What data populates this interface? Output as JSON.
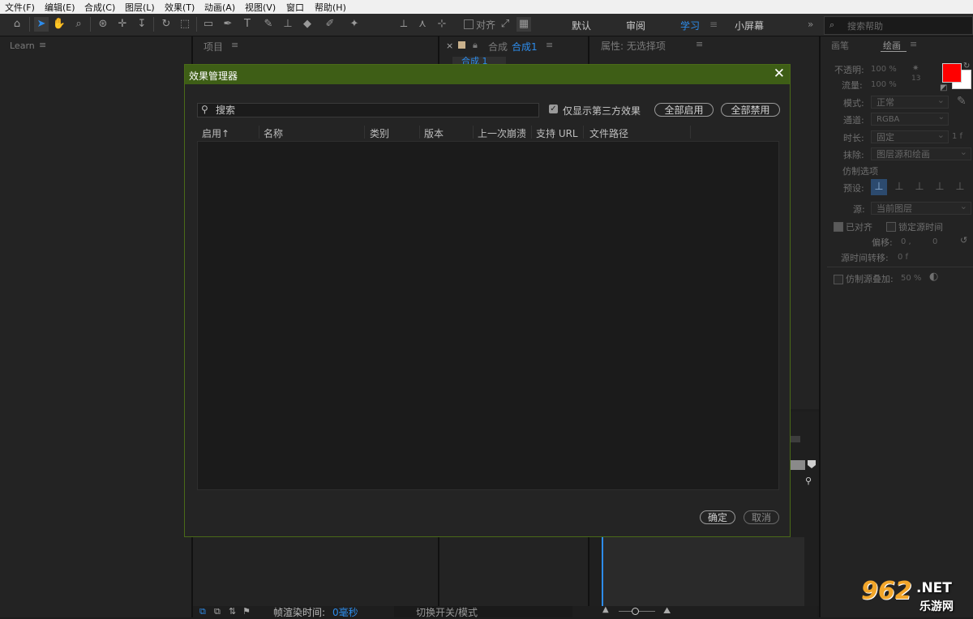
{
  "menu": [
    "文件(F)",
    "编辑(E)",
    "合成(C)",
    "图层(L)",
    "效果(T)",
    "动画(A)",
    "视图(V)",
    "窗口",
    "帮助(H)"
  ],
  "toolbar": {
    "align_label": "对齐",
    "workspaces": [
      "默认",
      "审阅",
      "学习",
      "小屏幕"
    ],
    "active_workspace": "学习",
    "overflow": "»",
    "search_placeholder": "搜索帮助"
  },
  "panels": {
    "learn_title": "Learn",
    "project_title": "项目",
    "comp_label": "合成",
    "comp_name": "合成1",
    "comp_tab": "合成 1",
    "properties_title": "属性: 无选择项",
    "close_x": "×"
  },
  "paint_panel": {
    "tabs": [
      "画笔",
      "绘画"
    ],
    "active_tab": "绘画",
    "opacity_label": "不透明:",
    "opacity_value": "100 %",
    "flow_label": "流量:",
    "flow_value": "100 %",
    "brush_size": "13",
    "mode_label": "模式:",
    "mode_value": "正常",
    "channel_label": "通道:",
    "channel_value": "RGBA",
    "duration_label": "时长:",
    "duration_value": "固定",
    "duration_frames": "1 f",
    "erase_label": "抹除:",
    "erase_value": "图层源和绘画",
    "clone_options": "仿制选项",
    "preset_label": "预设:",
    "source_label": "源:",
    "source_value": "当前图层",
    "aligned_label": "已对齐",
    "lock_time_label": "锁定源时间",
    "offset_label": "偏移:",
    "offset_x": "0 ,",
    "offset_y": "0",
    "time_shift_label": "源时间转移:",
    "time_shift_value": "0 f",
    "overlay_label": "仿制源叠加:",
    "overlay_value": "50 %",
    "fg_color": "#ff0000",
    "bg_color": "#ffffff"
  },
  "dialog": {
    "title": "效果管理器",
    "search_placeholder": "搜索",
    "third_party_only": "仅显示第三方效果",
    "enable_all": "全部启用",
    "disable_all": "全部禁用",
    "columns": [
      "启用",
      "名称",
      "类别",
      "版本",
      "上一次崩溃",
      "支持 URL",
      "文件路径"
    ],
    "sort_arrow": "↑",
    "ok": "确定",
    "cancel": "取消",
    "accent_color": "#3e5e16"
  },
  "status": {
    "render_time_label": "帧渲染时间:",
    "render_time_value": "0毫秒",
    "toggle_switches": "切换开关/模式"
  },
  "watermark": {
    "logo": "962",
    "net": ".NET",
    "site": "乐游网"
  }
}
